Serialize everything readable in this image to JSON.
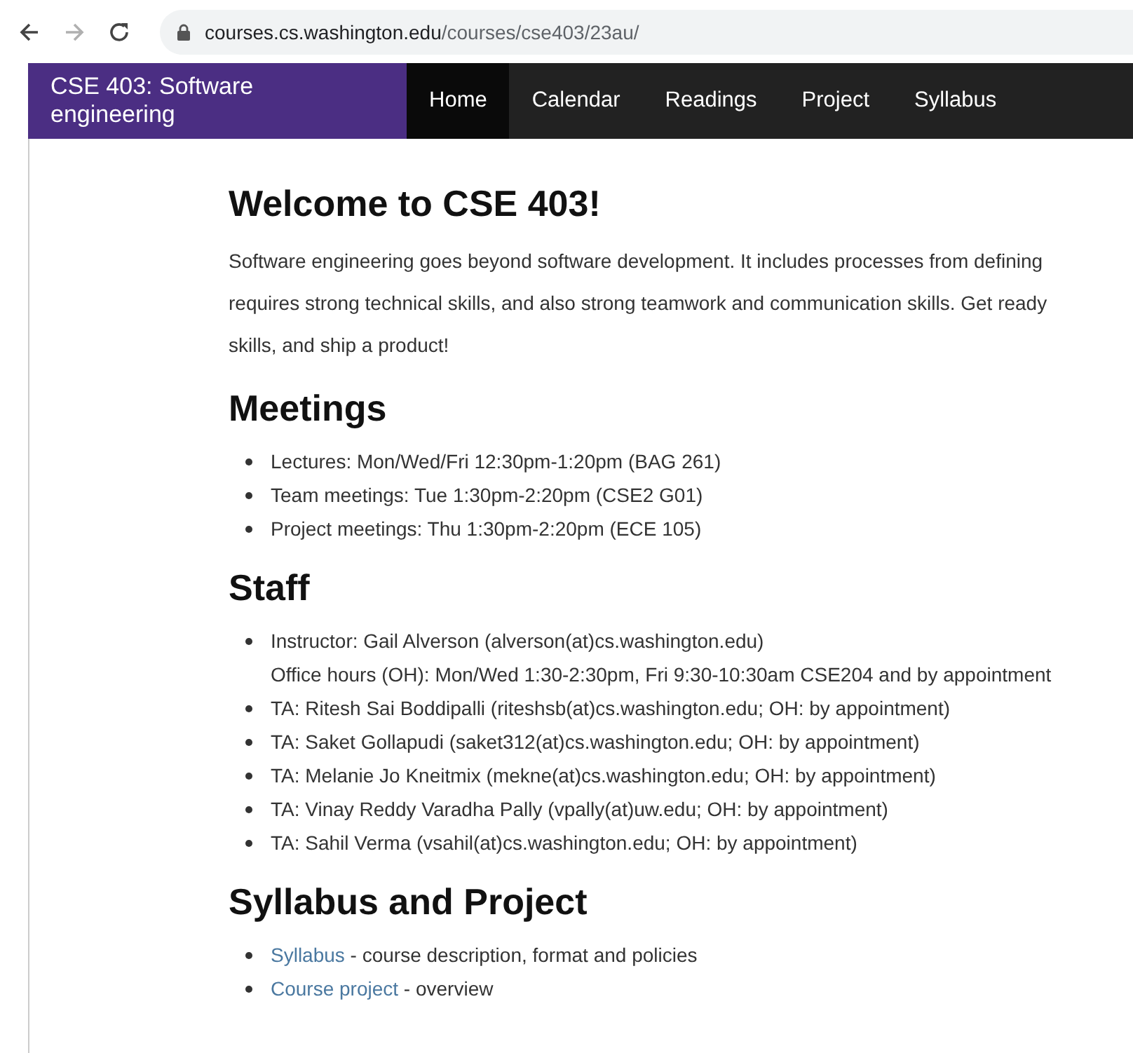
{
  "browser": {
    "url_host": "courses.cs.washington.edu",
    "url_path": "/courses/cse403/23au/",
    "forward_disabled": true
  },
  "navbar": {
    "brand": "CSE 403: Software engineering",
    "items": [
      {
        "label": "Home",
        "selected": true
      },
      {
        "label": "Calendar",
        "selected": false
      },
      {
        "label": "Readings",
        "selected": false
      },
      {
        "label": "Project",
        "selected": false
      },
      {
        "label": "Syllabus",
        "selected": false
      }
    ]
  },
  "content": {
    "title": "Welcome to CSE 403!",
    "intro_lines": [
      "Software engineering goes beyond software development. It includes processes from defining",
      "requires strong technical skills, and also strong teamwork and communication skills. Get ready",
      "skills, and ship a product!"
    ],
    "sections": [
      {
        "heading": "Meetings",
        "items": [
          {
            "text": "Lectures: Mon/Wed/Fri 12:30pm-1:20pm (BAG 261)"
          },
          {
            "text": "Team meetings: Tue 1:30pm-2:20pm (CSE2 G01)"
          },
          {
            "text": "Project meetings: Thu 1:30pm-2:20pm (ECE 105)"
          }
        ]
      },
      {
        "heading": "Staff",
        "items": [
          {
            "text": "Instructor: Gail Alverson (alverson(at)cs.washington.edu)",
            "note": "Office hours (OH): Mon/Wed 1:30-2:30pm, Fri 9:30-10:30am CSE204 and by appointment"
          },
          {
            "text": "TA: Ritesh Sai Boddipalli (riteshsb(at)cs.washington.edu; OH: by appointment)"
          },
          {
            "text": "TA: Saket Gollapudi (saket312(at)cs.washington.edu; OH: by appointment)"
          },
          {
            "text": "TA: Melanie Jo Kneitmix (mekne(at)cs.washington.edu; OH: by appointment)"
          },
          {
            "text": "TA: Vinay Reddy Varadha Pally (vpally(at)uw.edu; OH: by appointment)"
          },
          {
            "text": "TA: Sahil Verma (vsahil(at)cs.washington.edu; OH: by appointment)"
          }
        ]
      },
      {
        "heading": "Syllabus and Project",
        "items": [
          {
            "link": "Syllabus",
            "text": "- course description, format and policies"
          },
          {
            "link": "Course project",
            "text": "- overview"
          }
        ]
      }
    ]
  }
}
